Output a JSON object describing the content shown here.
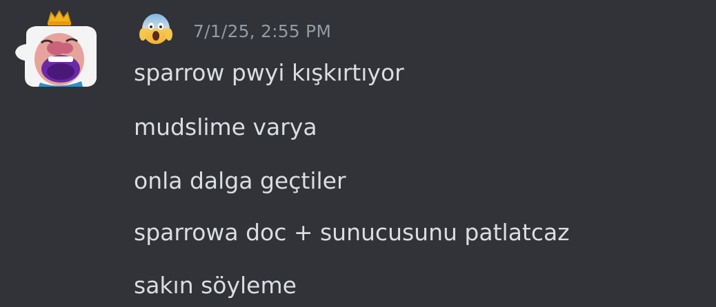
{
  "message": {
    "author_avatar": "clash-royale-king-laughing-emote",
    "author_name_emoji": "face-screaming-in-fear-emoji",
    "timestamp": "7/1/25, 2:55 PM",
    "lines": [
      "sparrow pwyi kışkırtıyor",
      "mudslime varya",
      "onla dalga geçtiler",
      "sparrowa doc + sunucusunu patlatcaz",
      "sakın söyleme"
    ]
  },
  "colors": {
    "background": "#313338",
    "text": "#dbdee1",
    "timestamp": "#949ba4"
  }
}
